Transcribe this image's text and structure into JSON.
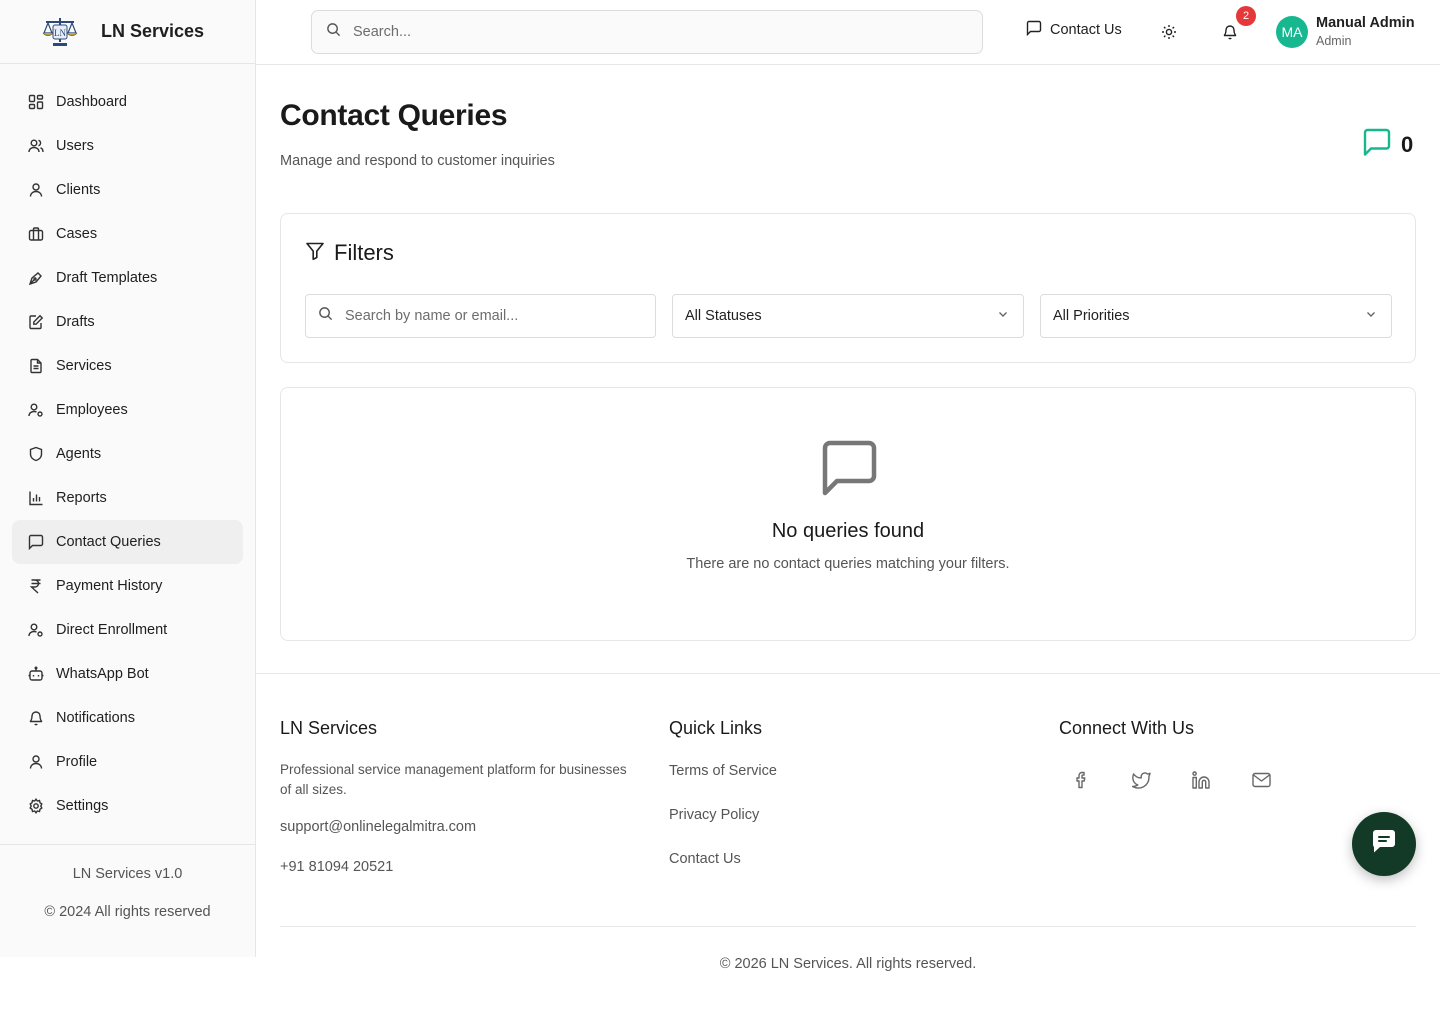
{
  "brand": {
    "name": "LN Services",
    "logo_icon": "scales-of-justice-logo"
  },
  "sidebar": {
    "items": [
      {
        "label": "Dashboard",
        "icon": "dashboard-icon"
      },
      {
        "label": "Users",
        "icon": "users-icon"
      },
      {
        "label": "Clients",
        "icon": "user-icon"
      },
      {
        "label": "Cases",
        "icon": "briefcase-icon"
      },
      {
        "label": "Draft Templates",
        "icon": "pen-tool-icon"
      },
      {
        "label": "Drafts",
        "icon": "edit-file-icon"
      },
      {
        "label": "Services",
        "icon": "file-text-icon"
      },
      {
        "label": "Employees",
        "icon": "user-cog-icon"
      },
      {
        "label": "Agents",
        "icon": "shield-icon"
      },
      {
        "label": "Reports",
        "icon": "bar-chart-icon"
      },
      {
        "label": "Contact Queries",
        "icon": "message-square-icon",
        "active": true
      },
      {
        "label": "Payment History",
        "icon": "rupee-icon"
      },
      {
        "label": "Direct Enrollment",
        "icon": "user-cog-icon"
      },
      {
        "label": "WhatsApp Bot",
        "icon": "bot-icon"
      },
      {
        "label": "Notifications",
        "icon": "bell-icon"
      },
      {
        "label": "Profile",
        "icon": "user-icon"
      },
      {
        "label": "Settings",
        "icon": "settings-icon"
      }
    ],
    "version": "LN Services v1.0",
    "copyright": "© 2024 All rights reserved"
  },
  "header": {
    "search_placeholder": "Search...",
    "contact_label": "Contact Us",
    "notification_count": "2",
    "user": {
      "initials": "MA",
      "name": "Manual Admin",
      "role": "Admin"
    }
  },
  "page": {
    "title": "Contact Queries",
    "subtitle": "Manage and respond to customer inquiries",
    "query_count": "0"
  },
  "filters": {
    "title": "Filters",
    "search_placeholder": "Search by name or email...",
    "status_value": "All Statuses",
    "priority_value": "All Priorities"
  },
  "empty_state": {
    "title": "No queries found",
    "message": "There are no contact queries matching your filters."
  },
  "footer": {
    "about": {
      "title": "LN Services",
      "description": "Professional service management platform for businesses of all sizes.",
      "email": "support@onlinelegalmitra.com",
      "phone": "+91 81094 20521"
    },
    "quick_links": {
      "title": "Quick Links",
      "links": [
        "Terms of Service",
        "Privacy Policy",
        "Contact Us"
      ]
    },
    "connect": {
      "title": "Connect With Us",
      "icons": [
        "facebook-icon",
        "twitter-icon",
        "linkedin-icon",
        "mail-icon"
      ]
    },
    "copyright": "© 2026 LN Services. All rights reserved."
  },
  "colors": {
    "accent": "#17b890",
    "active_nav_bg": "#efefef",
    "badge": "#e5383b",
    "chat_fab": "#123a26"
  }
}
